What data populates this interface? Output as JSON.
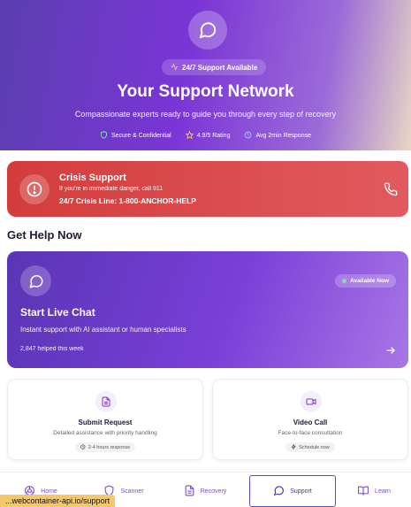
{
  "hero": {
    "badge": "24/7 Support Available",
    "title": "Your Support Network",
    "subtitle": "Compassionate experts ready to guide you through every step of recovery",
    "stats": [
      "Secure & Confidential",
      "4.9/5 Rating",
      "Avg 2min Response"
    ]
  },
  "crisis": {
    "title": "Crisis Support",
    "desc": "If you're in immediate danger, call 911",
    "line": "24/7 Crisis Line: 1-800-ANCHOR-HELP"
  },
  "section_title": "Get Help Now",
  "live_chat": {
    "badge": "Available Now",
    "title": "Start Live Chat",
    "desc": "Instant support with AI assistant or human specialists",
    "count": "2,847 helped this week"
  },
  "cards": [
    {
      "title": "Submit Request",
      "desc": "Detailed assistance with priority handling",
      "chip": "2-4 hours response",
      "icon": "document-icon"
    },
    {
      "title": "Video Call",
      "desc": "Face-to-face consultation",
      "chip": "Schedule now",
      "icon": "video-icon"
    }
  ],
  "nav": [
    {
      "label": "Home",
      "icon": "home-icon"
    },
    {
      "label": "Scanner",
      "icon": "shield-icon"
    },
    {
      "label": "Recovery",
      "icon": "document-icon"
    },
    {
      "label": "Support",
      "icon": "chat-icon",
      "active": true
    },
    {
      "label": "Learn",
      "icon": "book-icon"
    }
  ],
  "status_url": "...webcontainer-api.io/support",
  "colors": {
    "accent": "#7a35d6",
    "crisis": "#d33c3c",
    "success": "#7ee2a8"
  }
}
